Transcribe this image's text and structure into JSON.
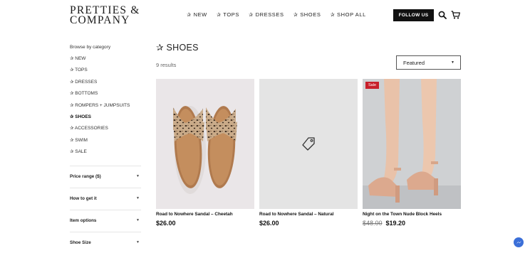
{
  "brand": {
    "line1": "PRETTIES &",
    "line2": "COMPANY"
  },
  "nav": {
    "items": [
      "✰ NEW",
      "✰ TOPS",
      "✰ DRESSES",
      "✰ SHOES",
      "✰ SHOP ALL"
    ]
  },
  "header": {
    "follow_label": "FOLLOW US",
    "search_icon": "search-icon",
    "cart_icon": "cart-icon"
  },
  "sidebar": {
    "title": "Browse by category",
    "categories": [
      "✰ NEW",
      "✰ TOPS",
      "✰ DRESSES",
      "✰ BOTTOMS",
      "✰ ROMPERS + JUMPSUITS",
      "✰ SHOES",
      "✰ ACCESSORIES",
      "✰ SWIM",
      "✰ SALE"
    ],
    "active": "✰ SHOES",
    "filters": [
      "Price range ($)",
      "How to get it",
      "Item options",
      "Shoe Size"
    ]
  },
  "main": {
    "title": "✰ SHOES",
    "results": "9 results",
    "sort": {
      "selected": "Featured"
    }
  },
  "products": [
    {
      "name": "Road to Nowhere Sandal – Cheetah",
      "price": "$26.00",
      "old_price": "",
      "badge": ""
    },
    {
      "name": "Road to Nowhere Sandal – Natural",
      "price": "$26.00",
      "old_price": "",
      "badge": ""
    },
    {
      "name": "Night on the Town Nude Block Heels",
      "price": "$19.20",
      "old_price": "$48.00",
      "badge": "Sale"
    }
  ],
  "colors": {
    "accent": "#111111",
    "sale": "#c8202b",
    "messenger": "#3b6fd8"
  }
}
